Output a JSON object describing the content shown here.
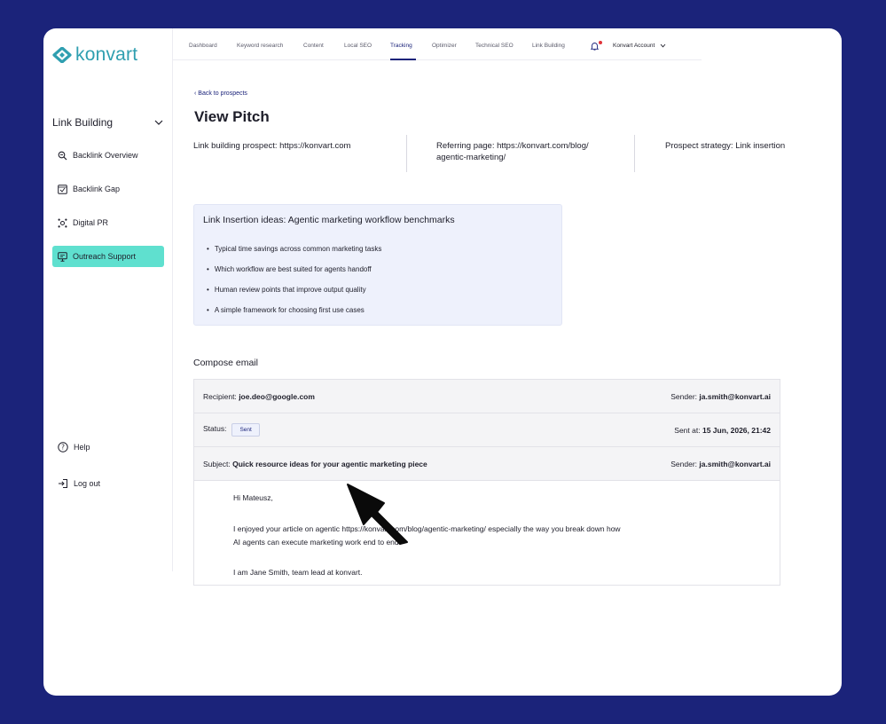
{
  "app": {
    "logo_text": "konvart",
    "brand_color": "#2f9fb0",
    "background_color": "#1b237a",
    "accent_color": "#5fe0cf"
  },
  "topnav": {
    "items": [
      {
        "label": "Dashboard"
      },
      {
        "label": "Keyword research"
      },
      {
        "label": "Content"
      },
      {
        "label": "Local SEO"
      },
      {
        "label": "Tracking",
        "active": true
      },
      {
        "label": "Optimizer"
      },
      {
        "label": "Technical SEO"
      },
      {
        "label": "Link Building"
      }
    ],
    "account_label": "Konvart Account",
    "notification_icon": "bell-icon"
  },
  "sidebar": {
    "section_title": "Link Building",
    "items": [
      {
        "label": "Backlink Overview",
        "icon": "backlink-overview-icon"
      },
      {
        "label": "Backlink Gap",
        "icon": "backlink-gap-icon"
      },
      {
        "label": "Digital PR",
        "icon": "digital-pr-icon"
      },
      {
        "label": "Outreach Support",
        "icon": "outreach-support-icon",
        "active": true
      }
    ],
    "help_label": "Help",
    "logout_label": "Log out"
  },
  "main": {
    "back_link": "Back to prospects",
    "title": "View Pitch",
    "prospect": "Link building prospect: https://konvart.com",
    "referring_line1": "Referring page: https://konvart.com/blog/",
    "referring_line2": "agentic-marketing/",
    "strategy": "Prospect strategy: Link insertion",
    "ideas_title": "Link Insertion ideas: Agentic marketing workflow benchmarks",
    "ideas": [
      "Typical time savings across common marketing tasks",
      "Which workflow are best suited for agents handoff",
      "Human review points that improve output quality",
      "A simple framework for choosing first use cases"
    ],
    "compose_title": "Compose email",
    "email": {
      "recipient_label": "Recipient:",
      "recipient": "joe.deo@google.com",
      "sender_label": "Sender:",
      "sender": "ja.smith@konvart.ai",
      "status_label": "Status:",
      "status": "Sent",
      "sent_at_label": "Sent at:",
      "sent_at": "15 Jun, 2026, 21:42",
      "subject_label": "Subject:",
      "subject": "Quick resource ideas for your agentic marketing piece",
      "greeting": "Hi Mateusz,",
      "line1": "I enjoyed your article on agentic https://konvart.com/blog/agentic-marketing/ especially the way you break down how",
      "line2": "AI agents can execute marketing work end to end.",
      "line3": "I am Jane Smith, team lead at konvart."
    }
  }
}
